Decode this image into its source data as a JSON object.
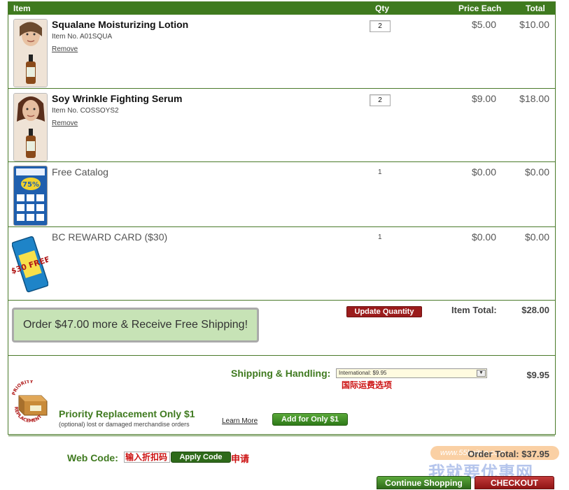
{
  "header": {
    "item": "Item",
    "qty": "Qty",
    "price_each": "Price Each",
    "total": "Total"
  },
  "items": [
    {
      "name": "Squalane Moisturizing Lotion",
      "item_no": "Item No. A01SQUA",
      "remove": "Remove",
      "qty": "2",
      "price": "$5.00",
      "total": "$10.00"
    },
    {
      "name": "Soy Wrinkle Fighting Serum",
      "item_no": "Item No. COSSOYS2",
      "remove": "Remove",
      "qty": "2",
      "price": "$9.00",
      "total": "$18.00"
    },
    {
      "name": "Free Catalog",
      "qty": "1",
      "price": "$0.00",
      "total": "$0.00",
      "image_text": "75%"
    },
    {
      "name": "BC REWARD CARD ($30)",
      "qty": "1",
      "price": "$0.00",
      "total": "$0.00",
      "image_text": "$30 FREE"
    }
  ],
  "summary": {
    "free_shipping": "Order $47.00 more & Receive Free Shipping!",
    "update_quantity": "Update Quantity",
    "item_total_label": "Item Total:",
    "item_total_value": "$28.00"
  },
  "shipping": {
    "label": "Shipping & Handling:",
    "selected": "International: $9.95",
    "annotation": "国际运费选项",
    "value": "$9.95",
    "priority_title": "Priority Replacement Only $1",
    "priority_sub": "(optional) lost or damaged merchandise orders",
    "learn_more": "Learn More",
    "add_button": "Add for Only $1",
    "badge_text": "PRIORITY REPLACEMENT"
  },
  "webcode": {
    "label": "Web Code:",
    "input_value": "输入折扣码",
    "apply": "Apply Code",
    "annotation": "申请",
    "order_total": "Order Total: $37.95",
    "watermark_pill": "www.55haitao.com"
  },
  "actions": {
    "continue": "Continue Shopping",
    "checkout": "CHECKOUT"
  },
  "watermark": "我就要优惠网",
  "colors": {
    "header_green": "#3f7a1f",
    "accent_red": "#9b1c1c",
    "free_ship_bg": "#c7e3b6"
  }
}
